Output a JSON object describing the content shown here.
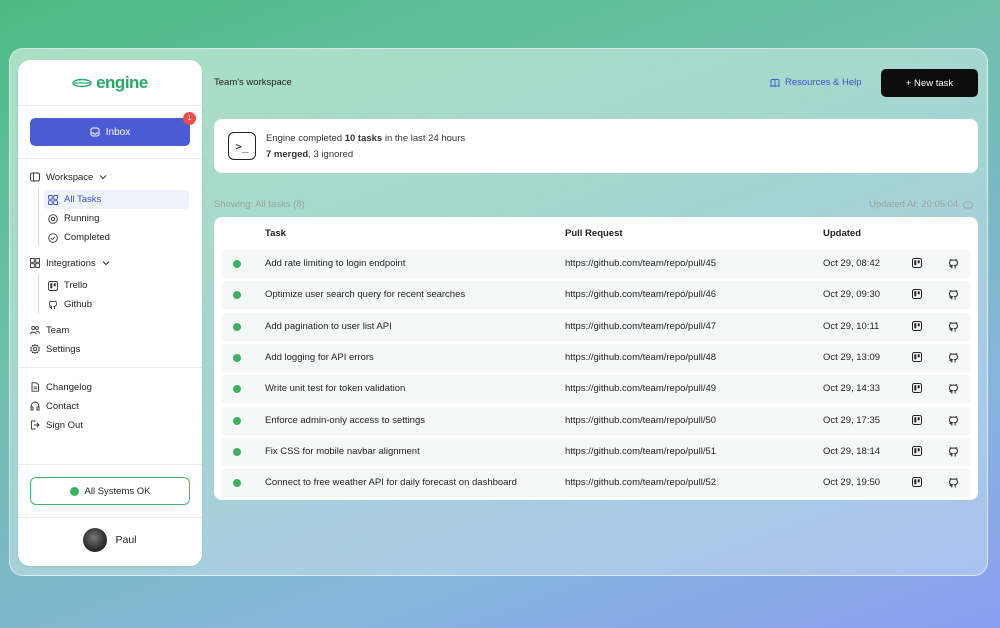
{
  "brand": {
    "logo_text": "engine",
    "accent": "#27a867"
  },
  "sidebar": {
    "inbox": {
      "label": "Inbox",
      "badge": "1"
    },
    "workspace": {
      "label": "Workspace",
      "items": [
        {
          "label": "All Tasks",
          "icon": "grid-icon",
          "active": true
        },
        {
          "label": "Running",
          "icon": "running-icon"
        },
        {
          "label": "Completed",
          "icon": "check-circle-icon"
        }
      ]
    },
    "integrations": {
      "label": "Integrations",
      "items": [
        {
          "label": "Trello",
          "icon": "trello-icon"
        },
        {
          "label": "Github",
          "icon": "github-icon"
        }
      ]
    },
    "team": "Team",
    "settings": "Settings",
    "changelog": "Changelog",
    "contact": "Contact",
    "sign_out": "Sign Out",
    "status": "All Systems OK",
    "user": "Paul"
  },
  "header": {
    "title": "Team's workspace",
    "resources": "Resources & Help",
    "new_task": "+ New task"
  },
  "summary": {
    "prefix": "Engine completed ",
    "tasks": "10 tasks",
    "suffix": " in the last 24 hours",
    "merged": "7 merged",
    "ignored": ", 3 ignored"
  },
  "filter": {
    "showing_label": "Showing: ",
    "showing_value": "All tasks (8)",
    "updated_at": "Updated At: 20:05:04"
  },
  "table": {
    "headers": {
      "task": "Task",
      "pr": "Pull Request",
      "updated": "Updated"
    },
    "rows": [
      {
        "task": "Add rate limiting to login endpoint",
        "pr": "https://github.com/team/repo/pull/45",
        "updated": "Oct 29, 08:42"
      },
      {
        "task": "Optimize user search query for recent searches",
        "pr": "https://github.com/team/repo/pull/46",
        "updated": "Oct 29, 09:30"
      },
      {
        "task": "Add pagination to user list API",
        "pr": "https://github.com/team/repo/pull/47",
        "updated": "Oct 29, 10:11"
      },
      {
        "task": "Add logging for API errors",
        "pr": "https://github.com/team/repo/pull/48",
        "updated": "Oct 29, 13:09"
      },
      {
        "task": "Write unit test for token validation",
        "pr": "https://github.com/team/repo/pull/49",
        "updated": "Oct 29, 14:33"
      },
      {
        "task": "Enforce admin-only access to settings",
        "pr": "https://github.com/team/repo/pull/50",
        "updated": "Oct 29, 17:35"
      },
      {
        "task": "Fix CSS for mobile navbar alignment",
        "pr": "https://github.com/team/repo/pull/51",
        "updated": "Oct 29, 18:14"
      },
      {
        "task": "Connect to free weather API for daily forecast on dashboard",
        "pr": "https://github.com/team/repo/pull/52",
        "updated": "Oct 29, 19:50"
      }
    ]
  }
}
